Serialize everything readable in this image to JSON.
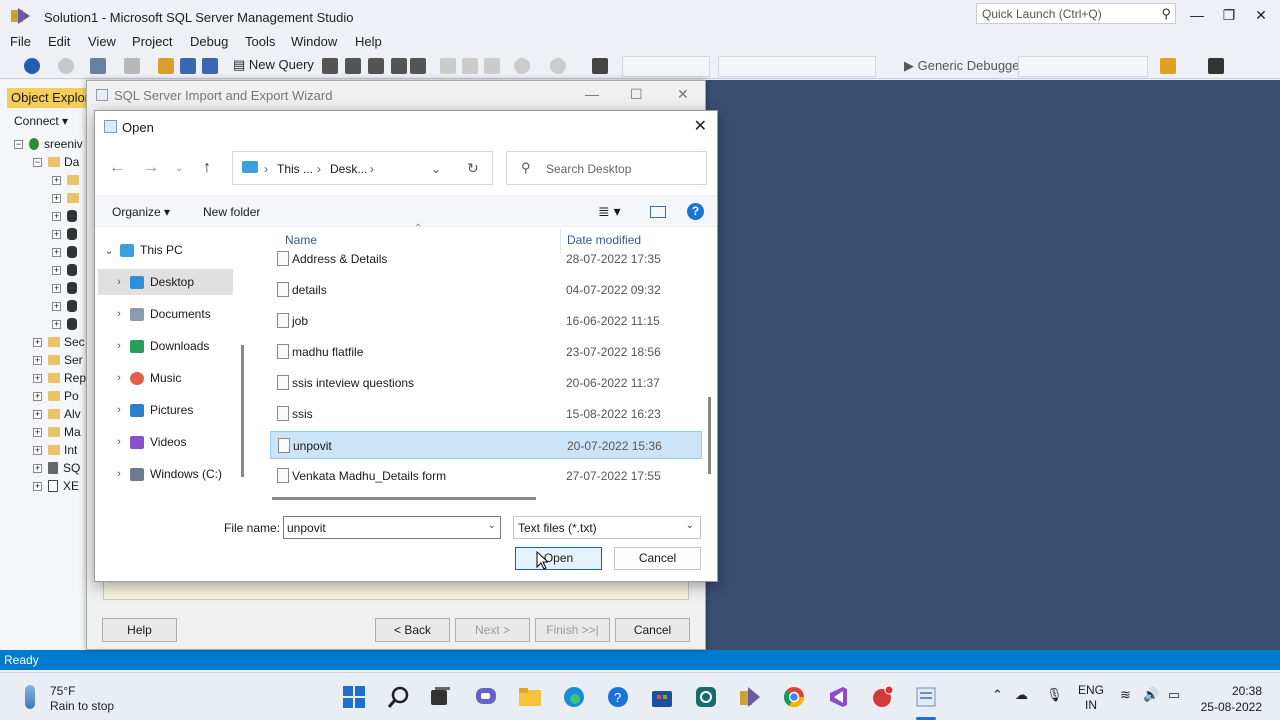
{
  "ssms": {
    "title": "Solution1 - Microsoft SQL Server Management Studio",
    "quick_launch_placeholder": "Quick Launch (Ctrl+Q)",
    "menu": [
      "File",
      "Edit",
      "View",
      "Project",
      "Debug",
      "Tools",
      "Window",
      "Help"
    ],
    "toolbar": {
      "new_query": "New Query",
      "debugger": "Generic Debugger"
    },
    "status": "Ready",
    "object_explorer": {
      "title": "Object Explorer",
      "connect": "Connect",
      "server": "sreeniv",
      "databases_label": "Da",
      "nodes": [
        "Sec",
        "Ser",
        "Rep",
        "Po",
        "Alv",
        "Ma",
        "Int",
        "SQ",
        "XE"
      ]
    }
  },
  "wizard": {
    "title": "SQL Server Import and Export Wizard",
    "buttons": {
      "help": "Help",
      "back": "< Back",
      "next": "Next >",
      "finish": "Finish >>|",
      "cancel": "Cancel"
    }
  },
  "dialog": {
    "title": "Open",
    "address": {
      "part1": "This ...",
      "part2": "Desk..."
    },
    "search_placeholder": "Search Desktop",
    "organize": "Organize",
    "new_folder": "New folder",
    "nav": [
      {
        "label": "This PC",
        "color": "#3aa0dc"
      },
      {
        "label": "Desktop",
        "color": "#2f8fd6"
      },
      {
        "label": "Documents",
        "color": "#8a9bb0"
      },
      {
        "label": "Downloads",
        "color": "#2a9d5a"
      },
      {
        "label": "Music",
        "color": "#e0604a"
      },
      {
        "label": "Pictures",
        "color": "#2b80c9"
      },
      {
        "label": "Videos",
        "color": "#8b4fc8"
      },
      {
        "label": "Windows (C:)",
        "color": "#6b7b8c"
      }
    ],
    "columns": {
      "name": "Name",
      "date": "Date modified"
    },
    "files": [
      {
        "name": "Address & Details",
        "date": "28-07-2022 17:35"
      },
      {
        "name": "details",
        "date": "04-07-2022 09:32"
      },
      {
        "name": "job",
        "date": "16-06-2022 11:15"
      },
      {
        "name": "madhu flatfile",
        "date": "23-07-2022 18:56"
      },
      {
        "name": "ssis inteview questions",
        "date": "20-06-2022 11:37"
      },
      {
        "name": "ssis",
        "date": "15-08-2022 16:23"
      },
      {
        "name": "unpovit",
        "date": "20-07-2022 15:36"
      },
      {
        "name": "Venkata Madhu_Details form",
        "date": "27-07-2022 17:55"
      }
    ],
    "selected_index": 6,
    "file_name_label": "File name:",
    "file_name_value": "unpovit",
    "file_type": "Text files (*.txt)",
    "open_button": "Open",
    "cancel_button": "Cancel"
  },
  "taskbar": {
    "temp": "75°F",
    "weather": "Rain to stop",
    "lang1": "ENG",
    "lang2": "IN",
    "time": "20:38",
    "date": "25-08-2022"
  }
}
